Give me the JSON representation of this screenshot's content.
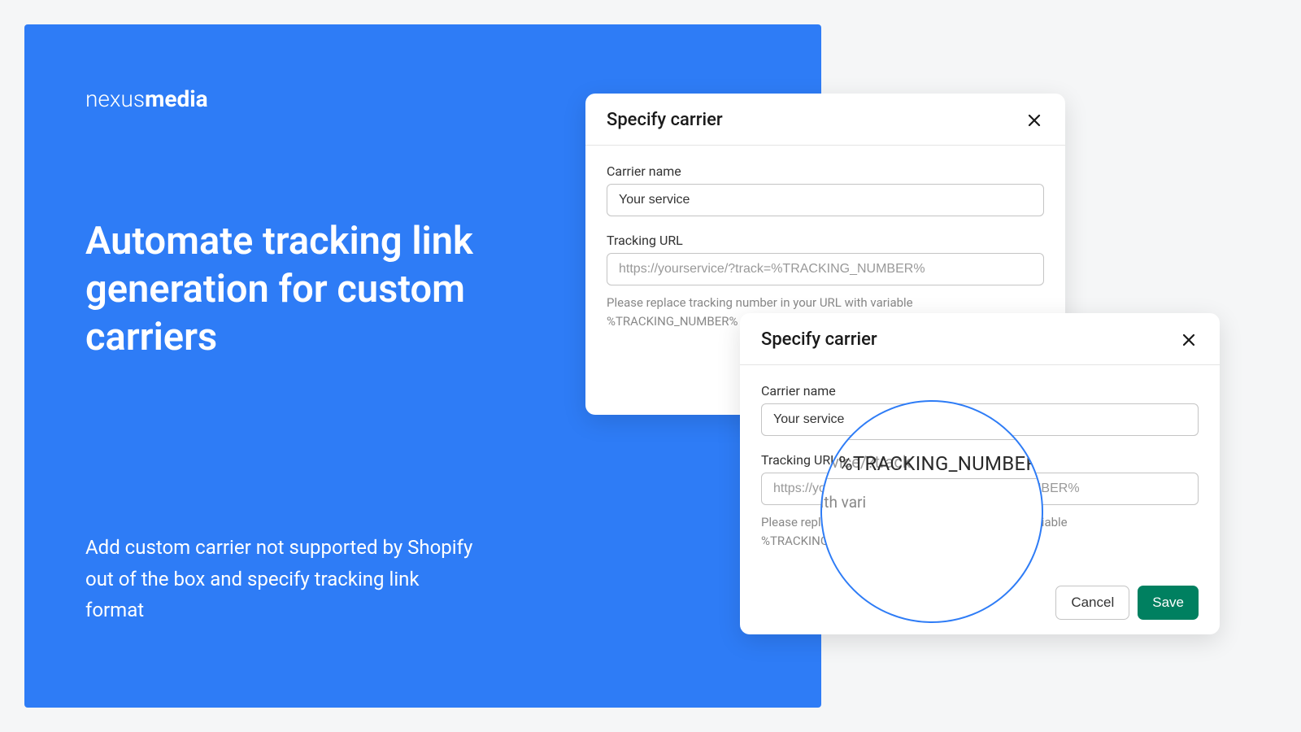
{
  "brand": {
    "light": "nexus",
    "bold": "media"
  },
  "hero": {
    "headline": "Automate tracking link generation for custom carriers",
    "subtext": "Add custom carrier not supported by Shopify out of the box and specify tracking link format"
  },
  "modal": {
    "title": "Specify carrier",
    "carrier_label": "Carrier name",
    "carrier_value": "Your service",
    "url_label": "Tracking URL",
    "url_placeholder": "https://yourservice/?track=%TRACKING_NUMBER%",
    "help_text": "Please replace tracking number in your URL with variable %TRACKING_NUMBER%",
    "cancel": "Cancel",
    "save": "Save"
  },
  "magnifier": {
    "token": "%TRACKING_NUMBER%",
    "url_prefix": "https://yourservice/?track",
    "help_partial": "er in your URL with vari"
  }
}
